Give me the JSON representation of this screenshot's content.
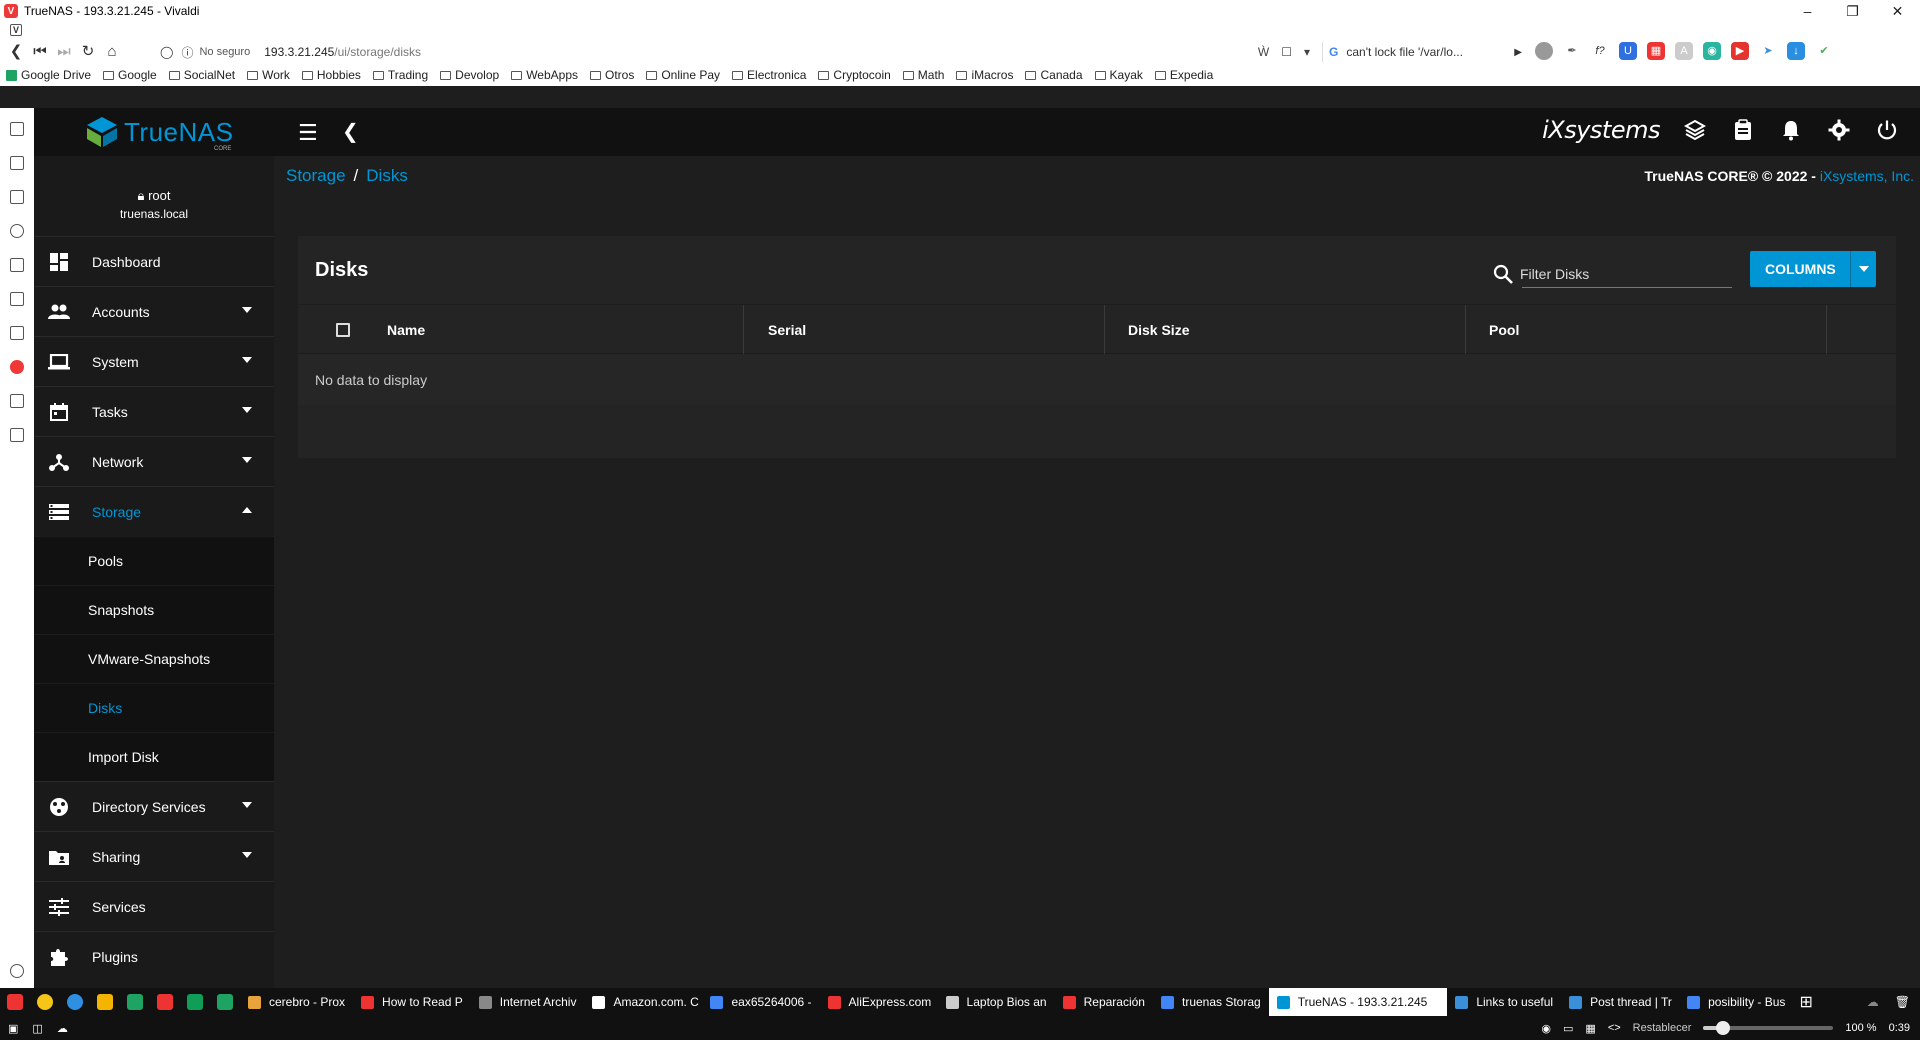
{
  "browser": {
    "window_title": "TrueNAS - 193.3.21.245 - Vivaldi",
    "security_label": "No seguro",
    "url_host": "193.3.21.245",
    "url_path": "/ui/storage/disks",
    "search_text": "can't lock file '/var/lo...",
    "bookmarks": [
      "Google Drive",
      "Google",
      "SocialNet",
      "Work",
      "Hobbies",
      "Trading",
      "Devolop",
      "WebApps",
      "Otros",
      "Online Pay",
      "Electronica",
      "Cryptocoin",
      "Math",
      "iMacros",
      "Canada",
      "Kayak",
      "Expedia"
    ],
    "taskbar_tabs": [
      "cerebro - Prox",
      "How to Read P",
      "Internet Archiv",
      "Amazon.com. C",
      "eax65264006 -",
      "AliExpress.com",
      "Laptop Bios an",
      "Reparación",
      "truenas Storag",
      "TrueNAS - 193.3.21.245",
      "Links to useful",
      "Post thread | Tr",
      "posibility - Bus"
    ],
    "active_tab_index": 9,
    "reset_label": "Restablecer",
    "zoom": "100 %",
    "clock": "0:39",
    "zoom_level": 0.15
  },
  "topbar": {
    "logo_text": "TrueNAS",
    "logo_sub": "CORE",
    "vendor": "iXsystems"
  },
  "user": {
    "name": "root",
    "host": "truenas.local"
  },
  "sidebar": {
    "items": [
      {
        "label": "Dashboard",
        "icon": "dashboard-icon",
        "caret": ""
      },
      {
        "label": "Accounts",
        "icon": "accounts-icon",
        "caret": "down"
      },
      {
        "label": "System",
        "icon": "laptop-icon",
        "caret": "down"
      },
      {
        "label": "Tasks",
        "icon": "calendar-icon",
        "caret": "down"
      },
      {
        "label": "Network",
        "icon": "network-icon",
        "caret": "down"
      },
      {
        "label": "Storage",
        "icon": "storage-icon",
        "caret": "up"
      },
      {
        "label": "Directory Services",
        "icon": "directory-icon",
        "caret": "down"
      },
      {
        "label": "Sharing",
        "icon": "folder-share-icon",
        "caret": "down"
      },
      {
        "label": "Services",
        "icon": "tune-icon",
        "caret": ""
      },
      {
        "label": "Plugins",
        "icon": "puzzle-icon",
        "caret": ""
      }
    ],
    "storage_sub": [
      "Pools",
      "Snapshots",
      "VMware-Snapshots",
      "Disks",
      "Import Disk"
    ],
    "active_sub": "Disks"
  },
  "breadcrumb": {
    "parent": "Storage",
    "sep": "/",
    "current": "Disks"
  },
  "copyright": {
    "text": "TrueNAS CORE® © 2022 - ",
    "link": "iXsystems, Inc."
  },
  "card": {
    "title": "Disks",
    "filter_placeholder": "Filter Disks",
    "columns_button": "COLUMNS",
    "headers": [
      "Name",
      "Serial",
      "Disk Size",
      "Pool"
    ],
    "empty_message": "No data to display"
  },
  "colors": {
    "accent": "#0095d5",
    "background": "#1e1e1e",
    "card": "#242424",
    "sidebar": "#1a1a1a",
    "topbar": "#111111"
  }
}
